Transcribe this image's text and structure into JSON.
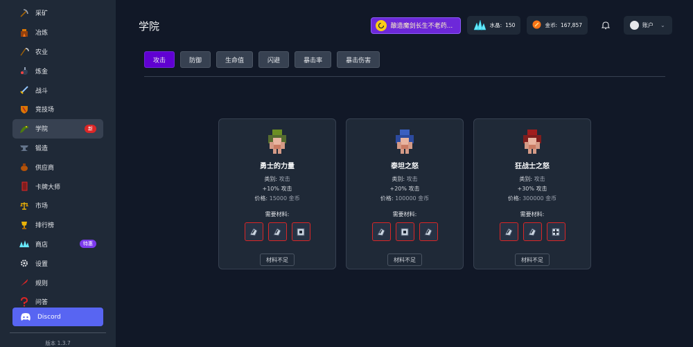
{
  "sidebar": {
    "items": [
      {
        "label": "采矿",
        "icon": "pickaxe-icon"
      },
      {
        "label": "冶炼",
        "icon": "furnace-icon"
      },
      {
        "label": "农业",
        "icon": "scythe-icon"
      },
      {
        "label": "炼金",
        "icon": "potion-icon"
      },
      {
        "label": "战斗",
        "icon": "sword-icon"
      },
      {
        "label": "竞技场",
        "icon": "shield-icon"
      },
      {
        "label": "学院",
        "icon": "dragon-icon",
        "badge": "新"
      },
      {
        "label": "锻造",
        "icon": "anvil-icon"
      },
      {
        "label": "供应商",
        "icon": "pot-icon"
      },
      {
        "label": "卡牌大师",
        "icon": "cards-icon"
      },
      {
        "label": "市场",
        "icon": "scales-icon"
      },
      {
        "label": "排行榜",
        "icon": "trophy-icon"
      },
      {
        "label": "商店",
        "icon": "gems-icon",
        "badge": "特惠"
      },
      {
        "label": "设置",
        "icon": "gear-icon"
      },
      {
        "label": "规则",
        "icon": "quill-icon"
      },
      {
        "label": "问答",
        "icon": "question-icon"
      }
    ],
    "discord_label": "Discord",
    "version": "版本 1.3.7"
  },
  "header": {
    "title": "学院",
    "quest": "酿造魔剑长生不老药...",
    "crystal_label": "水晶:",
    "crystal_value": "150",
    "gold_label": "金币:",
    "gold_value": "167,857",
    "account_label": "账户"
  },
  "tabs": [
    "攻击",
    "防御",
    "生命值",
    "闪避",
    "暴击率",
    "暴击伤害"
  ],
  "cards": [
    {
      "title": "勇士的力量",
      "category_label": "类别:",
      "category": "攻击",
      "effect": "+10% 攻击",
      "price_label": "价格:",
      "price": "15000 金币",
      "materials_label": "需要材料:",
      "button": "材料不足",
      "color": "#6b8e23"
    },
    {
      "title": "泰坦之怒",
      "category_label": "类别:",
      "category": "攻击",
      "effect": "+20% 攻击",
      "price_label": "价格:",
      "price": "100000 金币",
      "materials_label": "需要材料:",
      "button": "材料不足",
      "color": "#3b5fc0"
    },
    {
      "title": "狂战士之怒",
      "category_label": "类别:",
      "category": "攻击",
      "effect": "+30% 攻击",
      "price_label": "价格:",
      "price": "300000 金币",
      "materials_label": "需要材料:",
      "button": "材料不足",
      "color": "#a11d1d"
    }
  ]
}
